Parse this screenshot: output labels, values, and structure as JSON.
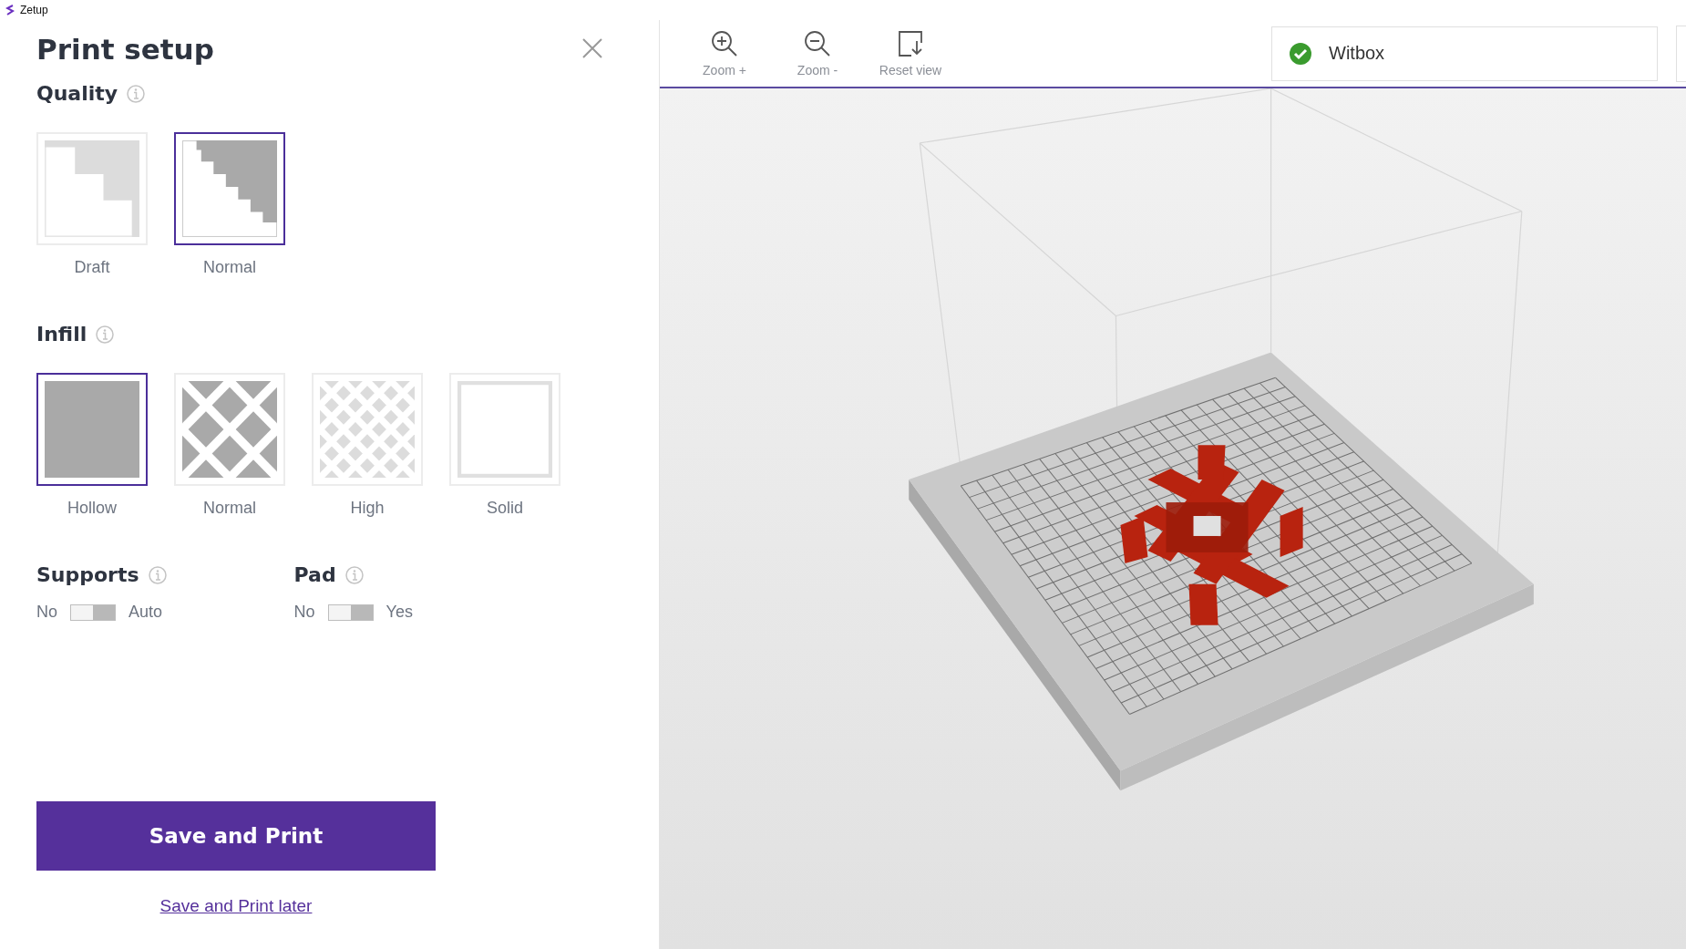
{
  "window": {
    "title": "Zetup"
  },
  "panel": {
    "title": "Print setup",
    "quality": {
      "label": "Quality",
      "options": [
        {
          "label": "Draft",
          "kind": "draft",
          "selected": false
        },
        {
          "label": "Normal",
          "kind": "fine",
          "selected": true
        }
      ]
    },
    "infill": {
      "label": "Infill",
      "options": [
        {
          "label": "Hollow",
          "kind": "hollow",
          "selected": true
        },
        {
          "label": "Normal",
          "kind": "lattice",
          "selected": false
        },
        {
          "label": "High",
          "kind": "dense",
          "selected": false
        },
        {
          "label": "Solid",
          "kind": "solid",
          "selected": false
        }
      ]
    },
    "toggles": [
      {
        "label": "Supports",
        "off_label": "No",
        "on_label": "Auto",
        "on": false
      },
      {
        "label": "Pad",
        "off_label": "No",
        "on_label": "Yes",
        "on": false
      }
    ],
    "primary_button": "Save and Print",
    "secondary_link": "Save and Print later"
  },
  "toolbar": {
    "buttons": [
      {
        "label": "Zoom +",
        "kind": "zoom-in"
      },
      {
        "label": "Zoom -",
        "kind": "zoom-out"
      },
      {
        "label": "Reset view",
        "kind": "reset"
      }
    ],
    "printer": {
      "name": "Witbox",
      "connected": true
    }
  }
}
